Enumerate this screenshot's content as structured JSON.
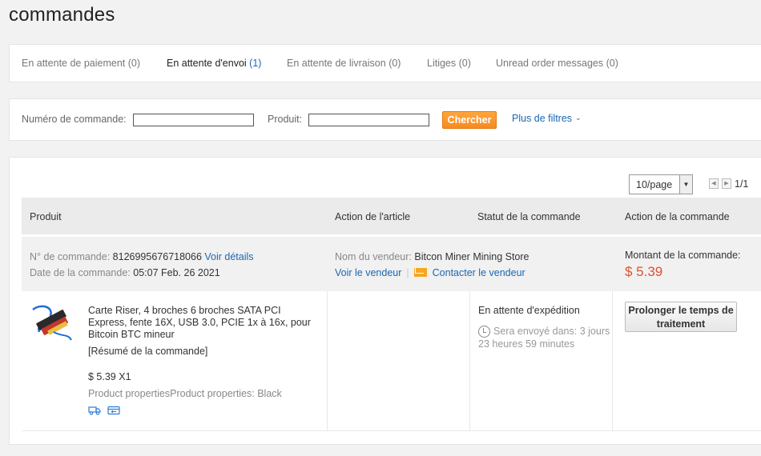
{
  "page": {
    "title": "commandes"
  },
  "tabs": [
    {
      "label": "En attente de paiement",
      "count": "(0)"
    },
    {
      "label": "En attente d'envoi",
      "count": "(1)"
    },
    {
      "label": "En attente de livraison",
      "count": "(0)"
    },
    {
      "label": "Litiges",
      "count": "(0)"
    },
    {
      "label": "Unread order messages",
      "count": "(0)"
    }
  ],
  "filters": {
    "order_number_label": "Numéro de commande:",
    "order_number_value": "",
    "product_label": "Produit:",
    "product_value": "",
    "search_label": "Chercher",
    "more_filters_label": "Plus de filtres"
  },
  "pagination": {
    "per_page": "10/page",
    "page_info": "1/1"
  },
  "table": {
    "headers": [
      "Produit",
      "Action de l'article",
      "Statut de la commande",
      "Action de la commande"
    ]
  },
  "order": {
    "number_label": "N° de commande:",
    "number": "8126995676718066",
    "details_link": "Voir détails",
    "date_label": "Date de la commande:",
    "date": "05:07 Feb. 26 2021",
    "seller_label": "Nom du vendeur:",
    "seller": "Bitcon Miner Mining Store",
    "view_seller": "Voir le vendeur",
    "contact_seller": "Contacter le vendeur",
    "amount_label": "Montant de la commande:",
    "amount": "$ 5.39",
    "item": {
      "title": "Carte Riser, 4 broches 6 broches SATA PCI Express, fente 16X, USB 3.0, PCIE 1x à 16x, pour Bitcoin BTC mineur",
      "summary": "[Résumé de la commande]",
      "price_qty": "$ 5.39 X1",
      "properties": "Product propertiesProduct properties: Black"
    },
    "status": "En attente d'expédition",
    "countdown": "Sera envoyé dans: 3 jours 23 heures 59 minutes",
    "extend_button": "Prolonger le temps de traitement"
  },
  "colors": {
    "accent_orange": "#f68b1f",
    "link_blue": "#1a67b2",
    "price_red": "#e0502d"
  }
}
